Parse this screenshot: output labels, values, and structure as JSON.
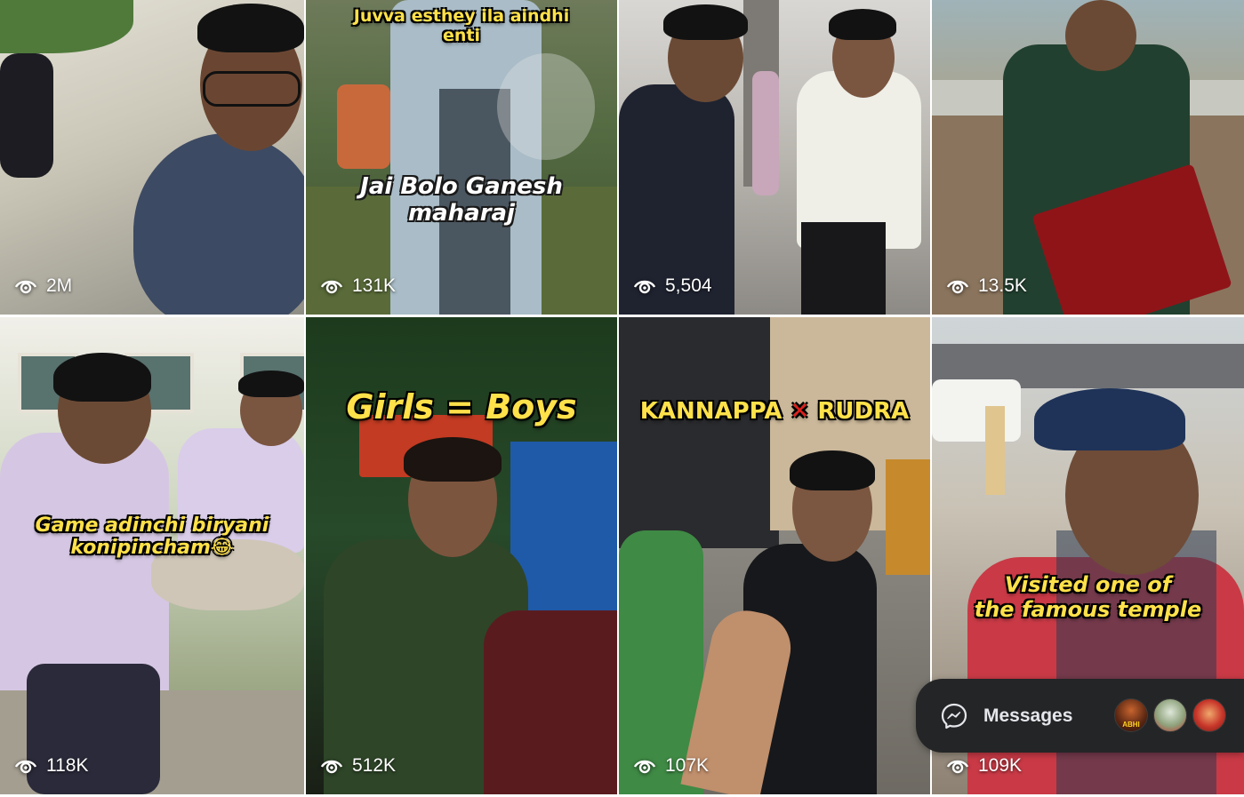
{
  "tiles": [
    {
      "views": "2M",
      "overlay": []
    },
    {
      "views": "131K",
      "overlay_top": [
        "Juvva esthey ila aindhi",
        "enti"
      ],
      "overlay": [
        "Jai Bolo Ganesh",
        "maharaj"
      ]
    },
    {
      "views": "5,504",
      "overlay": []
    },
    {
      "views": "13.5K",
      "overlay": []
    },
    {
      "views": "118K",
      "overlay": [
        "Game adinchi biryani",
        "konipincham😂"
      ]
    },
    {
      "views": "512K",
      "overlay": [
        "Girls = Boys"
      ]
    },
    {
      "views": "107K",
      "overlay_parts": [
        "KANNAPPA",
        "✕",
        "RUDRA"
      ]
    },
    {
      "views": "109K",
      "overlay": [
        "Visited one of",
        "the famous temple"
      ]
    }
  ],
  "messages": {
    "label": "Messages",
    "avatar_caption": "ABHI"
  },
  "colors": {
    "overlay_yellow": "#ffe14a",
    "cross_red": "#e0201c",
    "messages_bg": "#242526"
  },
  "icons": {
    "views": "eye-icon",
    "messages": "messenger-icon"
  }
}
